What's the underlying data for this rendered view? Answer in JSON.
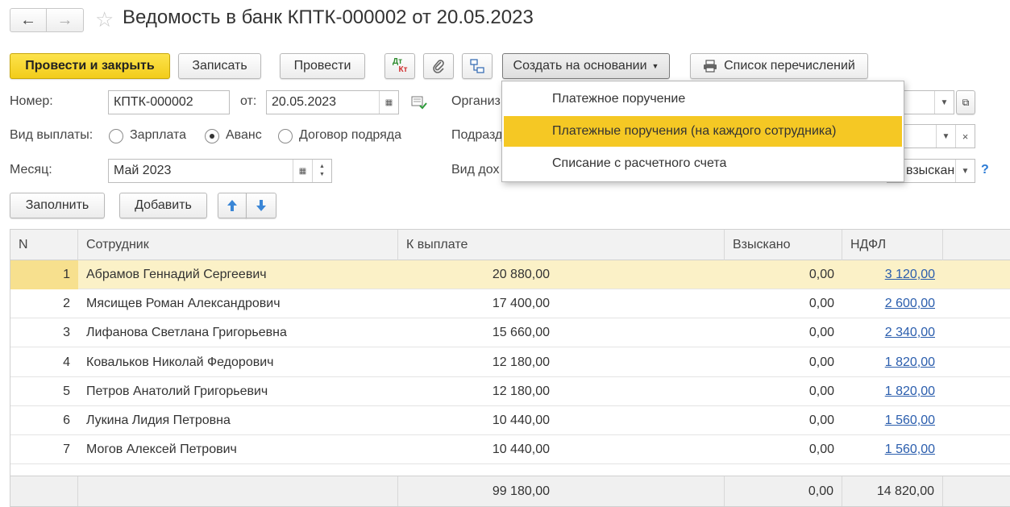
{
  "window": {
    "title": "Ведомость в банк КПТК-000002 от 20.05.2023"
  },
  "toolbar": {
    "post_close": "Провести и закрыть",
    "save": "Записать",
    "post": "Провести",
    "dtkt_top": "Дт",
    "dtkt_bottom": "Кт",
    "create_based": "Создать на основании",
    "transfers_list": "Список перечислений"
  },
  "dropdown": {
    "items": [
      {
        "label": "Платежное поручение"
      },
      {
        "label": "Платежные поручения (на каждого сотрудника)"
      },
      {
        "label": "Списание с расчетного счета"
      }
    ]
  },
  "form": {
    "number_label": "Номер:",
    "number_value": "КПТК-000002",
    "date_label": "от:",
    "date_value": "20.05.2023",
    "org_label": "Организ",
    "payment_type_label": "Вид выплаты:",
    "payment_types": [
      "Зарплата",
      "Аванс",
      "Договор подряда"
    ],
    "subdivision_label": "Подразд",
    "month_label": "Месяц:",
    "month_value": "Май 2023",
    "income_type_label": "Вид дох",
    "income_type_value": "взыскан",
    "help": "?"
  },
  "actions": {
    "fill": "Заполнить",
    "add": "Добавить"
  },
  "table": {
    "headers": [
      "N",
      "Сотрудник",
      "К выплате",
      "Взыскано",
      "НДФЛ"
    ],
    "rows": [
      {
        "n": "1",
        "employee": "Абрамов Геннадий Сергеевич",
        "pay": "20 880,00",
        "withheld": "0,00",
        "ndfl": "3 120,00"
      },
      {
        "n": "2",
        "employee": "Мясищев Роман Александрович",
        "pay": "17 400,00",
        "withheld": "0,00",
        "ndfl": "2 600,00"
      },
      {
        "n": "3",
        "employee": "Лифанова Светлана Григорьевна",
        "pay": "15 660,00",
        "withheld": "0,00",
        "ndfl": "2 340,00"
      },
      {
        "n": "4",
        "employee": "Ковальков Николай Федорович",
        "pay": "12 180,00",
        "withheld": "0,00",
        "ndfl": "1 820,00"
      },
      {
        "n": "5",
        "employee": "Петров Анатолий Григорьевич",
        "pay": "12 180,00",
        "withheld": "0,00",
        "ndfl": "1 820,00"
      },
      {
        "n": "6",
        "employee": "Лукина Лидия Петровна",
        "pay": "10 440,00",
        "withheld": "0,00",
        "ndfl": "1 560,00"
      },
      {
        "n": "7",
        "employee": "Могов Алексей Петрович",
        "pay": "10 440,00",
        "withheld": "0,00",
        "ndfl": "1 560,00"
      }
    ],
    "totals": {
      "pay": "99 180,00",
      "withheld": "0,00",
      "ndfl": "14 820,00"
    }
  },
  "colors": {
    "primary": "#f5c824",
    "selected_row": "#fbf1c7",
    "link": "#2a5dad"
  }
}
